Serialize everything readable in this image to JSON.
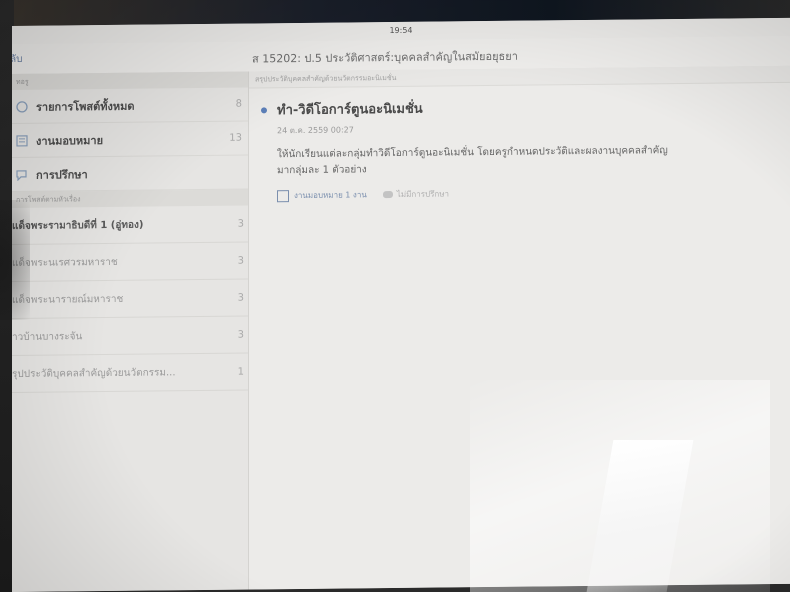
{
  "status": {
    "time": "19:54"
  },
  "nav": {
    "back": "ลับ",
    "title": "ส 15202: ป.5 ประวัติศาสตร์:บุคคลสำคัญในสมัยอยุธยา"
  },
  "sidebar": {
    "section1": "ทอรู",
    "items": [
      {
        "label": "รายการโพสต์ทั้งหมด",
        "count": "8",
        "icon": "circle-icon"
      },
      {
        "label": "งานมอบหมาย",
        "count": "13",
        "icon": "list-icon"
      },
      {
        "label": "การปรึกษา",
        "count": "",
        "icon": "chat-icon"
      }
    ],
    "section2": "การโพสต์ตามหัวเรื่อง",
    "topics": [
      {
        "label": "แด็จพระรามาธิบดีที่ 1 (อู่ทอง)",
        "count": "3",
        "faded": false
      },
      {
        "label": "แด็จพระนเรศวรมหาราช",
        "count": "3",
        "faded": true
      },
      {
        "label": "แด็จพระนารายณ์มหาราช",
        "count": "3",
        "faded": true
      },
      {
        "label": "าวบ้านบางระจัน",
        "count": "3",
        "faded": true
      },
      {
        "label": "รุปประวัติบุคคลสำคัญด้วยนวัตกรรม...",
        "count": "1",
        "faded": true
      }
    ]
  },
  "main": {
    "subtitle": "สรุปประวัติบุคคลสำคัญด้วยนวัตกรรมอะนิเมชั่น",
    "post": {
      "title": "ทำ-วิดีโอการ์ตูนอะนิเมชั่น",
      "date": "24 ต.ค. 2559 00:27",
      "body_line1": "ให้นักเรียนแต่ละกลุ่มทำวิดีโอการ์ตูนอะนิเมชั่น โดยครูกำหนดประวัติและผลงานบุคคลสำคัญ",
      "body_line2": "มากลุ่มละ 1 ตัวอย่าง",
      "meta_assign": "งานมอบหมาย 1 งาน",
      "meta_consult": "ไม่มีการปรึกษา"
    }
  },
  "colors": {
    "accent": "#5c7fb8",
    "background": "#ecebe9"
  }
}
